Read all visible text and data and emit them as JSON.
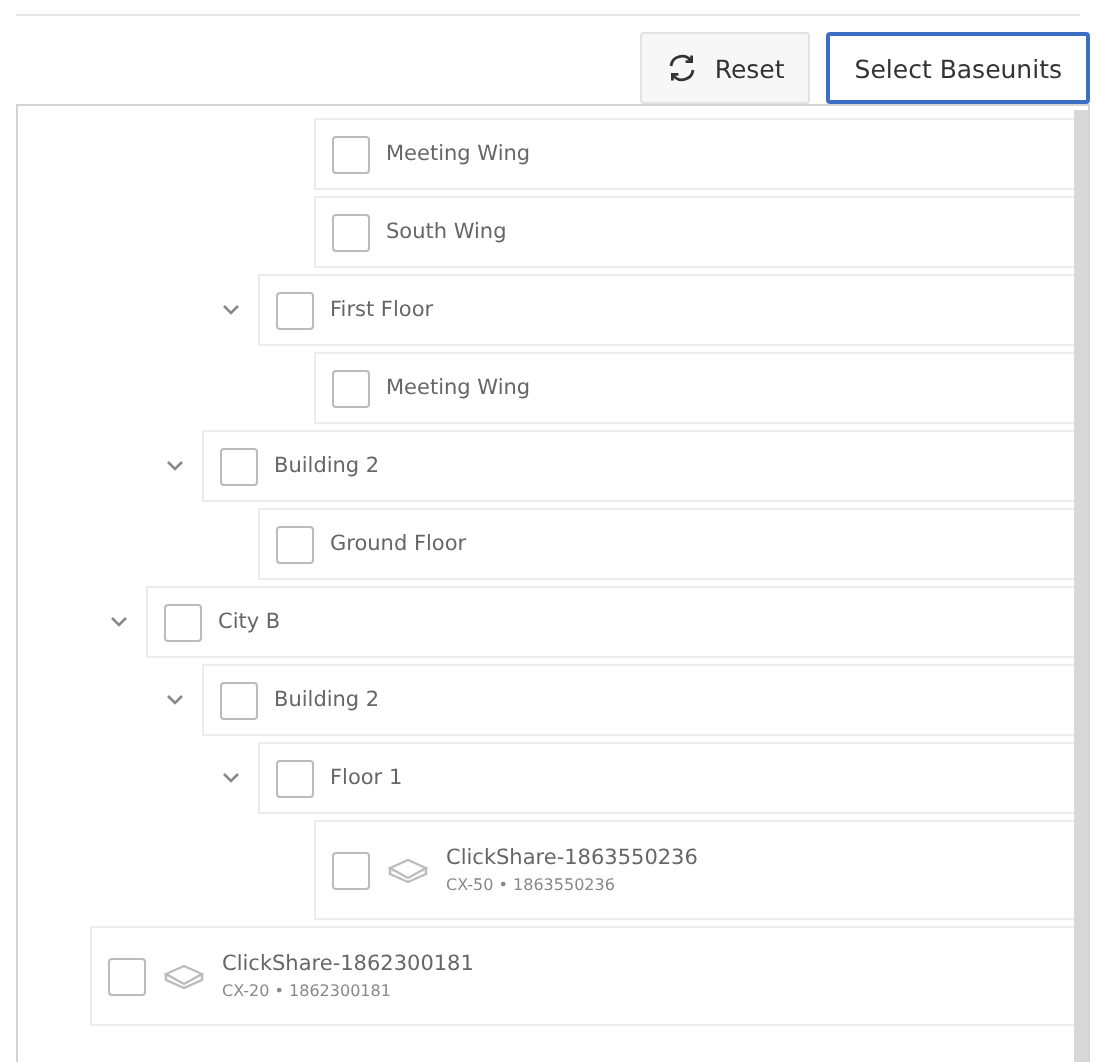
{
  "toolbar": {
    "reset_button": "Reset",
    "select_button": "Select Baseunits"
  },
  "tree": [
    {
      "children": [
        {
          "children": [
            {
              "children": [
                {
                  "children": [
                    {
                      "label": "Meeting Wing",
                      "checked": false
                    },
                    {
                      "label": "South Wing",
                      "checked": false
                    }
                  ]
                },
                {
                  "label": "First Floor",
                  "checked": false,
                  "expanded": true,
                  "children": [
                    {
                      "label": "Meeting Wing",
                      "checked": false
                    }
                  ]
                }
              ]
            },
            {
              "label": "Building 2",
              "checked": false,
              "expanded": true,
              "children": [
                {
                  "label": "Ground Floor",
                  "checked": false
                }
              ]
            }
          ]
        },
        {
          "label": "City B",
          "checked": false,
          "expanded": true,
          "children": [
            {
              "label": "Building 2",
              "checked": false,
              "expanded": true,
              "children": [
                {
                  "label": "Floor 1",
                  "checked": false,
                  "expanded": true,
                  "children": [
                    {
                      "kind": "device",
                      "label": "ClickShare-1863550236",
                      "detail": "CX-50 • 1863550236",
                      "checked": false
                    }
                  ]
                }
              ]
            }
          ]
        }
      ]
    },
    {
      "kind": "device",
      "label": "ClickShare-1862300181",
      "detail": "CX-20 • 1862300181",
      "checked": false
    }
  ]
}
